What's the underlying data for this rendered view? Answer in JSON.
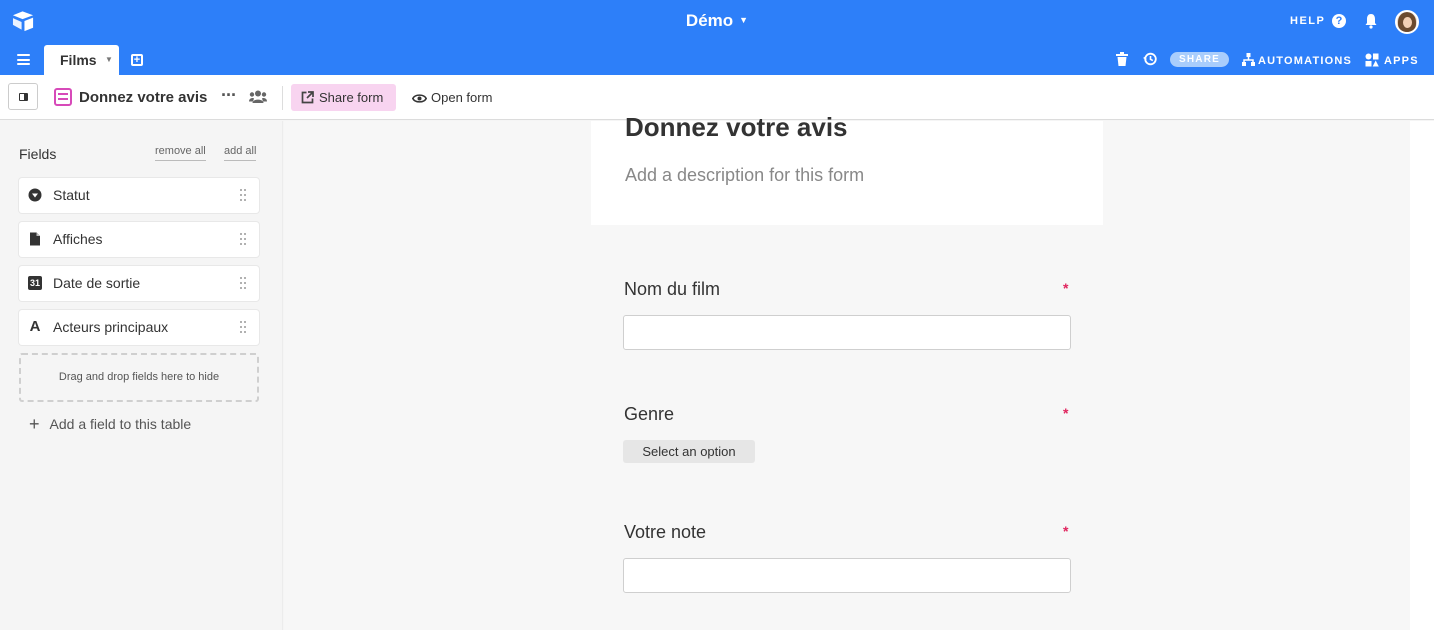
{
  "app": {
    "base_title": "Démo",
    "help_label": "HELP"
  },
  "tabbar": {
    "active_table": "Films",
    "share_label": "SHARE",
    "automations_label": "AUTOMATIONS",
    "apps_label": "APPS"
  },
  "viewbar": {
    "view_name": "Donnez votre avis",
    "more_label": "···",
    "share_form_label": "Share form",
    "open_form_label": "Open form"
  },
  "sidebar": {
    "title": "Fields",
    "remove_all": "remove all",
    "add_all": "add all",
    "fields": [
      {
        "label": "Statut",
        "icon": "single-select-icon"
      },
      {
        "label": "Affiches",
        "icon": "attachment-icon"
      },
      {
        "label": "Date de sortie",
        "icon": "date-icon",
        "glyph": "31"
      },
      {
        "label": "Acteurs principaux",
        "icon": "text-icon",
        "glyph": "A"
      }
    ],
    "dropzone_text": "Drag and drop fields here to hide",
    "add_field_label": "Add a field to this table"
  },
  "form": {
    "title": "Donnez votre avis",
    "description_placeholder": "Add a description for this form",
    "questions": [
      {
        "label": "Nom du film",
        "required_mark": "*",
        "type": "text",
        "value": ""
      },
      {
        "label": "Genre",
        "required_mark": "*",
        "type": "select",
        "select_label": "Select an option"
      },
      {
        "label": "Votre note",
        "required_mark": "*",
        "type": "text",
        "value": ""
      }
    ]
  },
  "colors": {
    "brand_blue": "#2d7ff9",
    "form_pink": "#d74ab9",
    "required_red": "#e0245e"
  }
}
